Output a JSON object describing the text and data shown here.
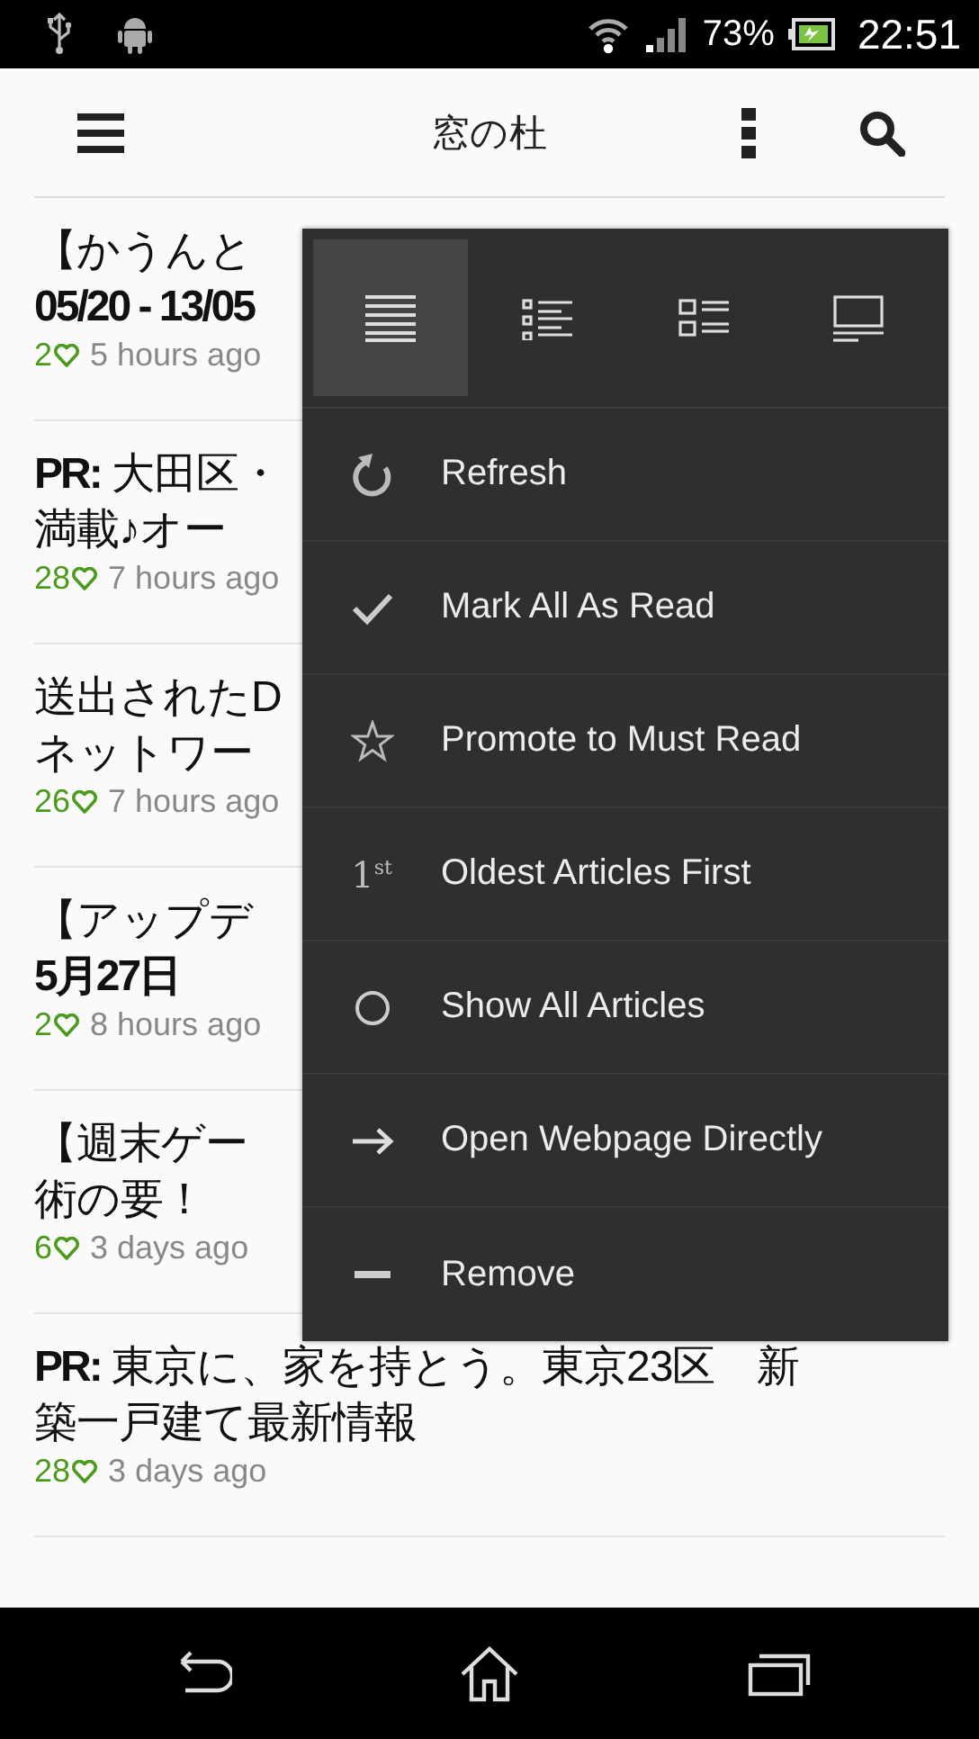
{
  "status_bar": {
    "battery": "73%",
    "time": "22:51"
  },
  "app_bar": {
    "title": "窓の杜"
  },
  "articles": [
    {
      "lines": [
        {
          "text": "【かうんと",
          "bold": false
        },
        {
          "text": "05/20 - 13/05",
          "bold": true
        }
      ],
      "likes": "2",
      "time": "5 hours ago"
    },
    {
      "lines": [
        {
          "text": "**PR:** 大田区・",
          "bold": false
        },
        {
          "text": "満載♪オー",
          "bold": false
        }
      ],
      "likes": "28",
      "time": "7 hours ago"
    },
    {
      "lines": [
        {
          "text": "送出されたD",
          "bold": false
        },
        {
          "text": "ネットワー",
          "bold": false
        }
      ],
      "likes": "26",
      "time": "7 hours ago"
    },
    {
      "lines": [
        {
          "text": "【アップデ",
          "bold": false
        },
        {
          "text": "5月27日",
          "bold": true
        }
      ],
      "likes": "2",
      "time": "8 hours ago"
    },
    {
      "lines": [
        {
          "text": "【週末ゲー",
          "bold": false
        },
        {
          "text": "術の要！",
          "bold": false
        }
      ],
      "likes": "6",
      "time": "3 days ago"
    },
    {
      "lines": [
        {
          "text": "**PR:** 東京に、家を持とう。東京23区　新築一戸建て最新情報",
          "bold": false
        }
      ],
      "likes": "28",
      "time": "3 days ago"
    }
  ],
  "menu": {
    "view_modes": [
      {
        "kind": "plain",
        "selected": true
      },
      {
        "kind": "bulleted",
        "selected": false
      },
      {
        "kind": "grid",
        "selected": false
      },
      {
        "kind": "card",
        "selected": false
      }
    ],
    "items": [
      {
        "kind": "refresh",
        "label": "Refresh"
      },
      {
        "kind": "check",
        "label": "Mark All As Read"
      },
      {
        "kind": "star",
        "label": "Promote to Must Read"
      },
      {
        "kind": "ordinal",
        "icon_label": "1$^{st}$",
        "label": "Oldest Articles First"
      },
      {
        "kind": "circle",
        "label": "Show All Articles"
      },
      {
        "kind": "arrow",
        "label": "Open Webpage Directly"
      },
      {
        "kind": "minus",
        "label": "Remove"
      }
    ]
  }
}
